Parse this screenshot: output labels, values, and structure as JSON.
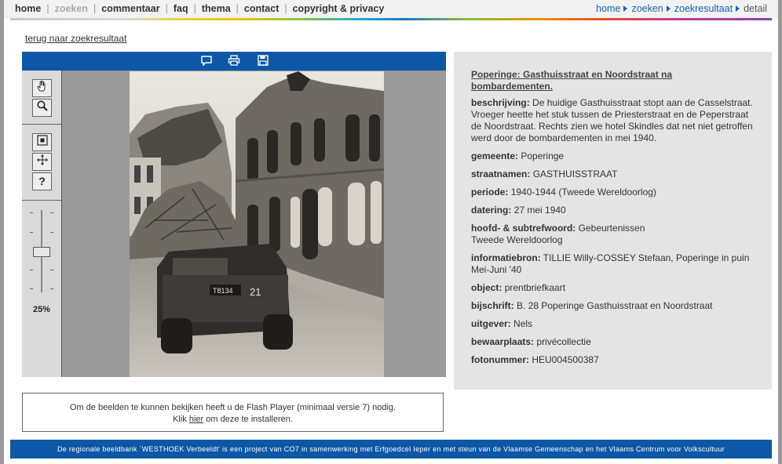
{
  "nav": {
    "items": [
      {
        "label": "home",
        "enabled": true
      },
      {
        "label": "zoeken",
        "enabled": false
      },
      {
        "label": "commentaar",
        "enabled": true
      },
      {
        "label": "faq",
        "enabled": true
      },
      {
        "label": "thema",
        "enabled": true
      },
      {
        "label": "contact",
        "enabled": true
      },
      {
        "label": "copyright & privacy",
        "enabled": true
      }
    ],
    "separator": "|"
  },
  "breadcrumb": {
    "items": [
      "home",
      "zoeken",
      "zoekresultaat"
    ],
    "current": "detail"
  },
  "back_link": "terug naar zoekresultaat",
  "viewer": {
    "toolbar_icons": [
      "comment-icon",
      "print-icon",
      "save-icon"
    ],
    "tools": [
      "hand-icon",
      "zoom-icon",
      "fit-icon",
      "move-icon",
      "help-icon"
    ],
    "help_label": "?",
    "zoom_label": "25%",
    "zoom_level": 0.25
  },
  "record": {
    "title": "Poperinge: Gasthuisstraat en Noordstraat na bombardementen.",
    "fields": [
      {
        "label": "beschrijving:",
        "value": "De huidige Gasthuisstraat stopt aan de Casselstraat. Vroeger heette het stuk tussen de Priesterstraat en de Peperstraat de Noordstraat. Rechts zien we hotel Skindles dat net niet getroffen werd door de bombardementen in mei 1940."
      },
      {
        "label": "gemeente:",
        "value": "Poperinge"
      },
      {
        "label": "straatnamen:",
        "value": "GASTHUISSTRAAT"
      },
      {
        "label": "periode:",
        "value": "1940-1944 (Tweede Wereldoorlog)"
      },
      {
        "label": "datering:",
        "value": "27 mei 1940"
      },
      {
        "label": "hoofd- & subtrefwoord:",
        "value": "Gebeurtenissen",
        "value2": "Tweede Wereldoorlog"
      },
      {
        "label": "informatiebron:",
        "value": "TILLIE Willy-COSSEY Stefaan, Poperinge in puin Mei-Juni '40"
      },
      {
        "label": "object:",
        "value": "prentbriefkaart"
      },
      {
        "label": "bijschrift:",
        "value": "B. 28 Poperinge Gasthuisstraat en Noordstraat"
      },
      {
        "label": "uitgever:",
        "value": "Nels"
      },
      {
        "label": "bewaarplaats:",
        "value": "privécollectie"
      },
      {
        "label": "fotonummer:",
        "value": "HEU004500387"
      }
    ]
  },
  "photo": {
    "vehicle_plate_left": "T8134",
    "vehicle_plate_right": "21"
  },
  "flash_note": {
    "line1": "Om de beelden te kunnen bekijken heeft u de Flash Player (minimaal versie 7) nodig.",
    "line2_pre": "Klik ",
    "line2_link": "hier",
    "line2_post": " om deze te installeren."
  },
  "footer": "De regionale beeldbank `WESTHOEK Verbeeldt' is een project van CO7 in samenwerking met Erfgoedcel Ieper en met steun van de Vlaamse Gemeenschap en het Vlaams Centrum voor Volkscultuur",
  "colors": {
    "brand_blue": "#0d57a6",
    "link_blue": "#1a5fb4",
    "panel_gray": "#e4e4e4"
  }
}
